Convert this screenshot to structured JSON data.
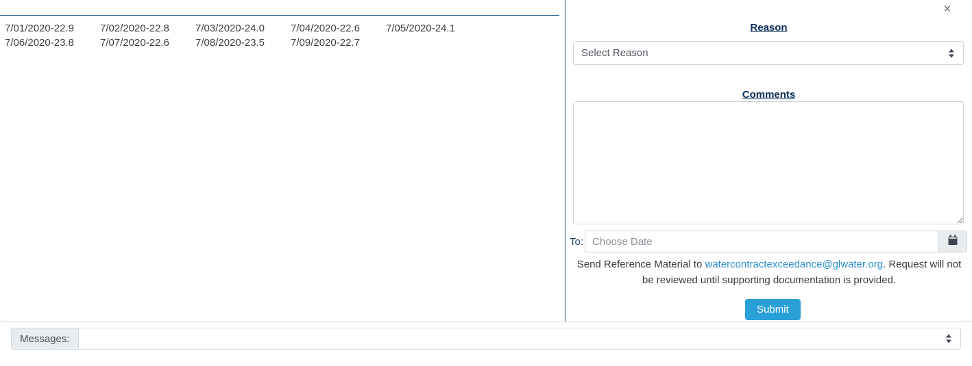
{
  "left_panel": {
    "readings": [
      "7/01/2020-22.9",
      "7/02/2020-22.8",
      "7/03/2020-24.0",
      "7/04/2020-22.6",
      "7/05/2020-24.1",
      "7/06/2020-23.8",
      "7/07/2020-22.6",
      "7/08/2020-23.5",
      "7/09/2020-22.7"
    ]
  },
  "right_panel": {
    "close_label": "×",
    "reason": {
      "heading": "Reason",
      "selected_option": "Select Reason"
    },
    "comments": {
      "heading": "Comments",
      "value": "",
      "placeholder": ""
    },
    "to_date": {
      "label": "To:",
      "value": "",
      "placeholder": "Choose Date",
      "calendar_icon": "calendar-icon"
    },
    "reference_note": {
      "prefix": "Send Reference Material to ",
      "email": "watercontractexceedance@glwater.org",
      "suffix": ". Request will not be reviewed until supporting documentation is provided."
    },
    "submit_label": "Submit"
  },
  "messages_bar": {
    "label": "Messages:",
    "selected_option": ""
  },
  "colors": {
    "divider_blue": "#2f6a96",
    "heading_navy": "#0c2d5a",
    "link_blue": "#2a8fd0",
    "submit_blue": "#29a0d8",
    "input_border": "#ced4da",
    "group_addon": "#e9ecef"
  }
}
